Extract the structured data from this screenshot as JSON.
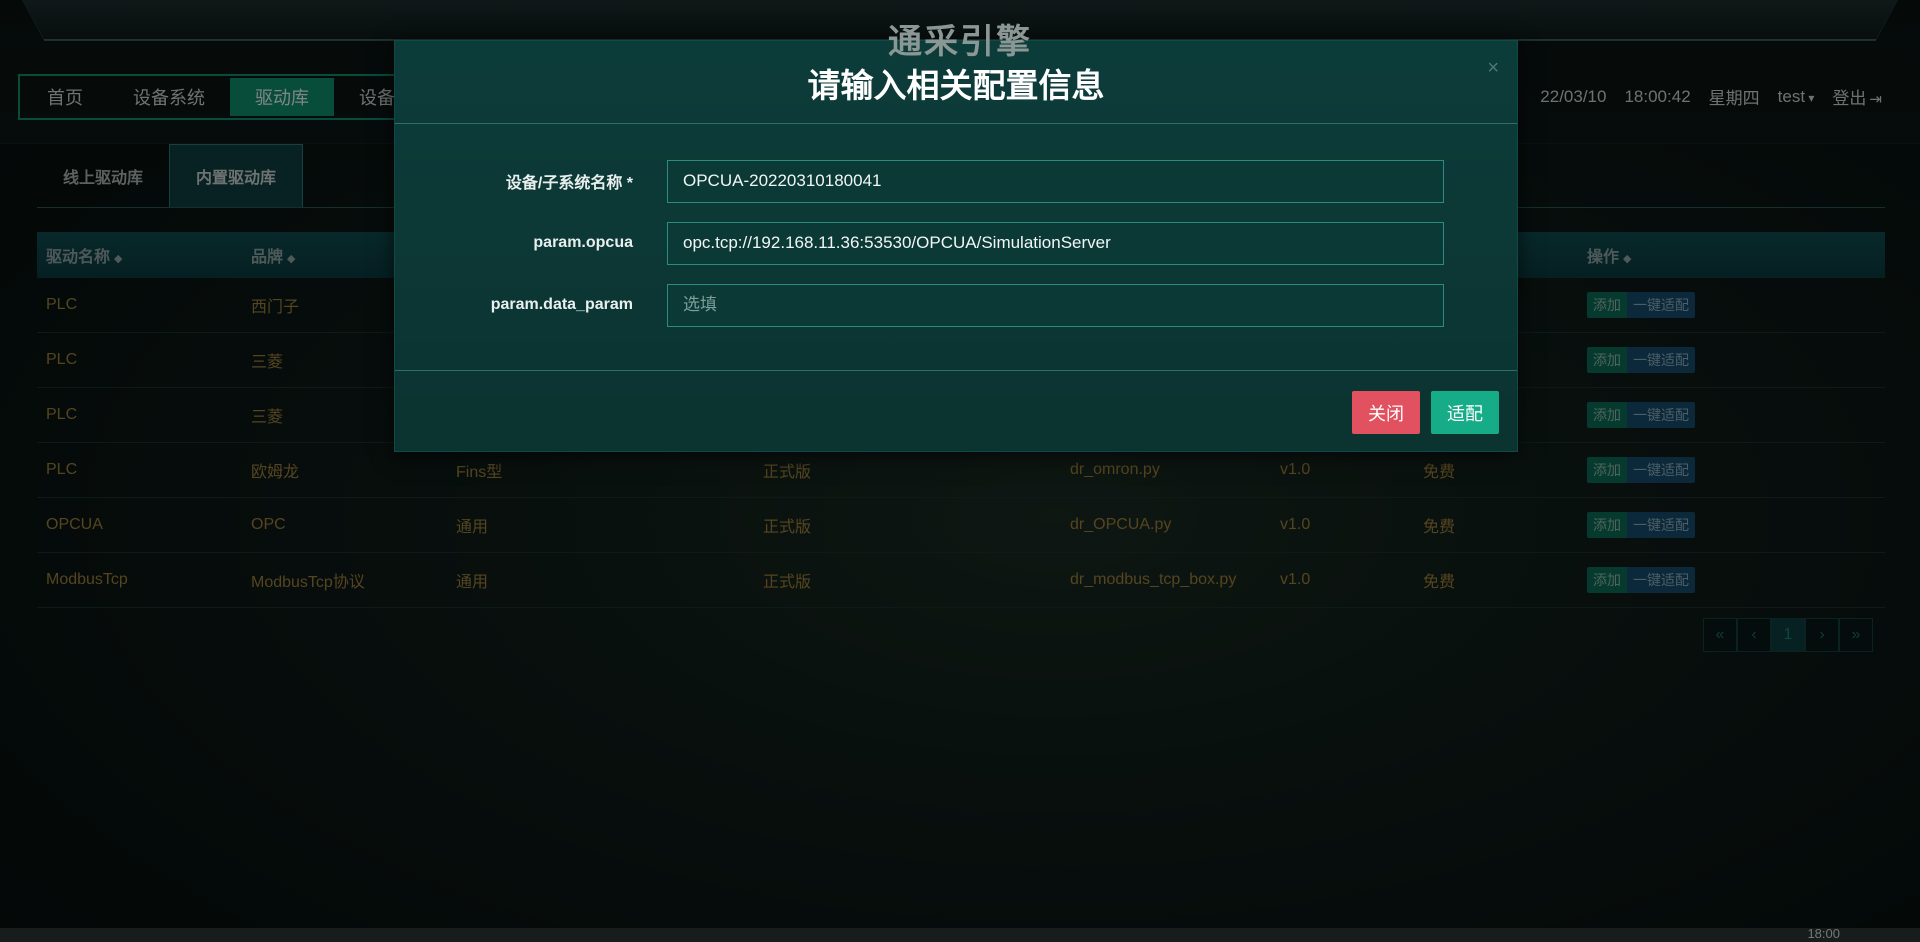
{
  "header": {
    "app_title": "通采引擎",
    "nav": [
      {
        "label": "首页"
      },
      {
        "label": "设备系统"
      },
      {
        "label": "驱动库"
      },
      {
        "label": "设备"
      }
    ],
    "date": "22/03/10",
    "time": "18:00:42",
    "weekday": "星期四",
    "user": "test",
    "logout": "登出"
  },
  "tabs": [
    {
      "label": "线上驱动库"
    },
    {
      "label": "内置驱动库"
    }
  ],
  "table": {
    "columns": [
      "驱动名称",
      "品牌",
      "",
      "",
      "",
      "",
      "",
      "操作"
    ],
    "rows": [
      {
        "name": "PLC",
        "brand": "西门子",
        "model": "",
        "edition": "",
        "file": "",
        "version": "",
        "price": ""
      },
      {
        "name": "PLC",
        "brand": "三菱",
        "model": "",
        "edition": "",
        "file": "",
        "version": "",
        "price": ""
      },
      {
        "name": "PLC",
        "brand": "三菱",
        "model": "",
        "edition": "",
        "file": "",
        "version": "",
        "price": ""
      },
      {
        "name": "PLC",
        "brand": "欧姆龙",
        "model": "Fins型",
        "edition": "正式版",
        "file": "dr_omron.py",
        "version": "v1.0",
        "price": "免费"
      },
      {
        "name": "OPCUA",
        "brand": "OPC",
        "model": "通用",
        "edition": "正式版",
        "file": "dr_OPCUA.py",
        "version": "v1.0",
        "price": "免费"
      },
      {
        "name": "ModbusTcp",
        "brand": "ModbusTcp协议",
        "model": "通用",
        "edition": "正式版",
        "file": "dr_modbus_tcp_box.py",
        "version": "v1.0",
        "price": "免费"
      }
    ],
    "action_add": "添加",
    "action_adapt": "一键适配"
  },
  "pager": {
    "first": "«",
    "prev": "‹",
    "current": "1",
    "next": "›",
    "last": "»"
  },
  "taskbar": {
    "clock": "18:00"
  },
  "modal": {
    "title": "请输入相关配置信息",
    "close_glyph": "×",
    "fields": [
      {
        "label": "设备/子系统名称 *",
        "value": "OPCUA-20220310180041",
        "placeholder": ""
      },
      {
        "label": "param.opcua",
        "value": "opc.tcp://192.168.11.36:53530/OPCUA/SimulationServer",
        "placeholder": ""
      },
      {
        "label": "param.data_param",
        "value": "",
        "placeholder": "选填"
      }
    ],
    "close_label": "关闭",
    "submit_label": "适配"
  }
}
